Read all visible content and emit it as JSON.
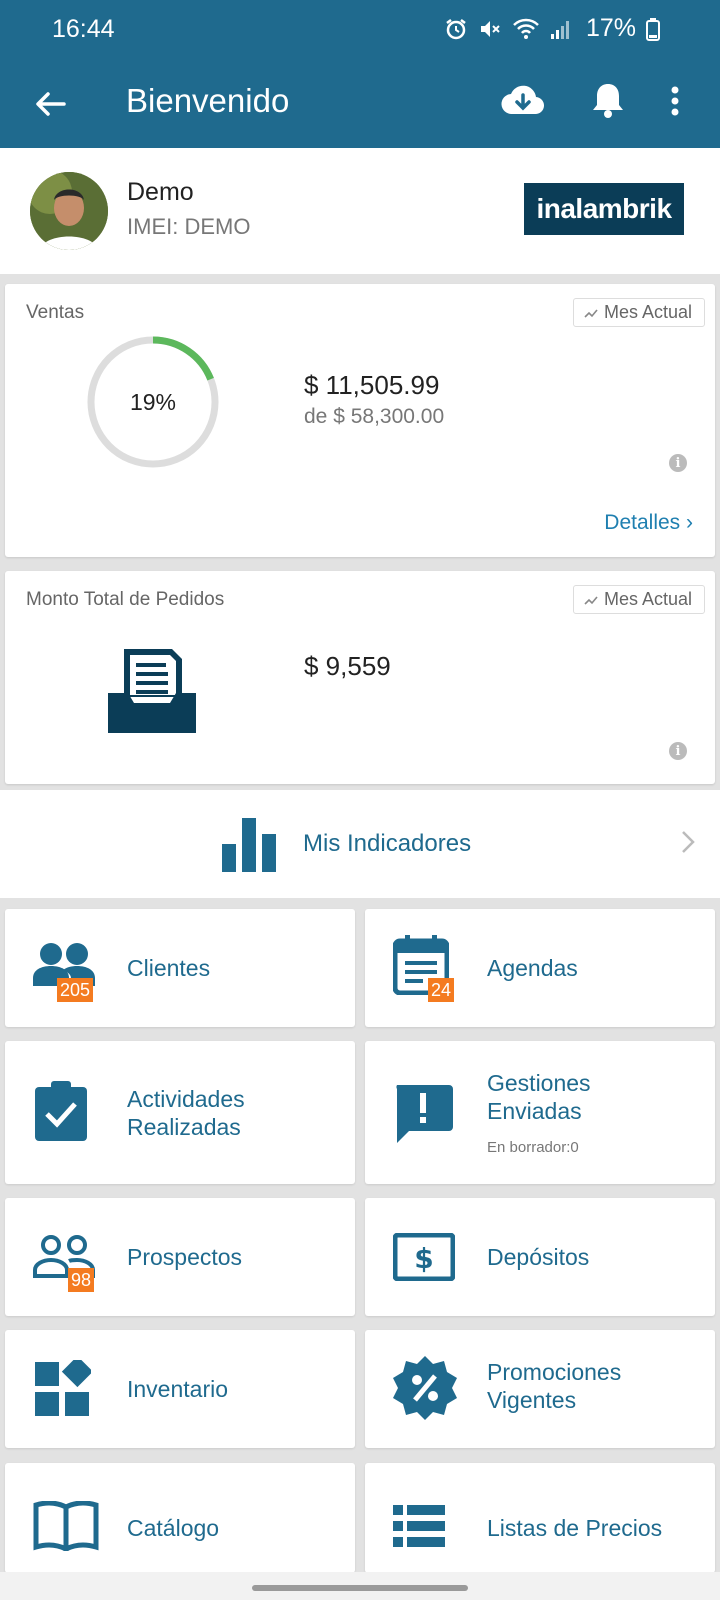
{
  "status_bar": {
    "time": "16:44",
    "battery": "17%"
  },
  "app_bar": {
    "title": "Bienvenido"
  },
  "profile": {
    "name": "Demo",
    "imei": "IMEI: DEMO",
    "logo_text": "inalambrik"
  },
  "ventas": {
    "label": "Ventas",
    "period": "Mes Actual",
    "percent_text": "19%",
    "progress": 0.19,
    "amount": "$ 11,505.99",
    "goal": "de $ 58,300.00",
    "details": "Detalles"
  },
  "pedidos": {
    "label": "Monto Total de Pedidos",
    "period": "Mes Actual",
    "amount": "$ 9,559"
  },
  "indicadores": {
    "label": "Mis Indicadores"
  },
  "tiles": {
    "clientes": {
      "label": "Clientes",
      "badge": "205"
    },
    "agendas": {
      "label": "Agendas",
      "badge": "24"
    },
    "actividades": {
      "line1": "Actividades",
      "line2": "Realizadas"
    },
    "gestiones": {
      "line1": "Gestiones",
      "line2": "Enviadas",
      "sub": "En borrador:0"
    },
    "prospectos": {
      "label": "Prospectos",
      "badge": "98"
    },
    "depositos": {
      "label": "Depósitos"
    },
    "inventario": {
      "label": "Inventario"
    },
    "promociones": {
      "line1": "Promociones",
      "line2": "Vigentes"
    },
    "catalogo": {
      "label": "Catálogo"
    },
    "listas": {
      "label": "Listas de Precios"
    }
  },
  "colors": {
    "primary": "#1f6a8e",
    "badge": "#f47b20",
    "ring_progress": "#5cb85c",
    "ring_track": "#dddddd",
    "link": "#1f7fb0"
  }
}
